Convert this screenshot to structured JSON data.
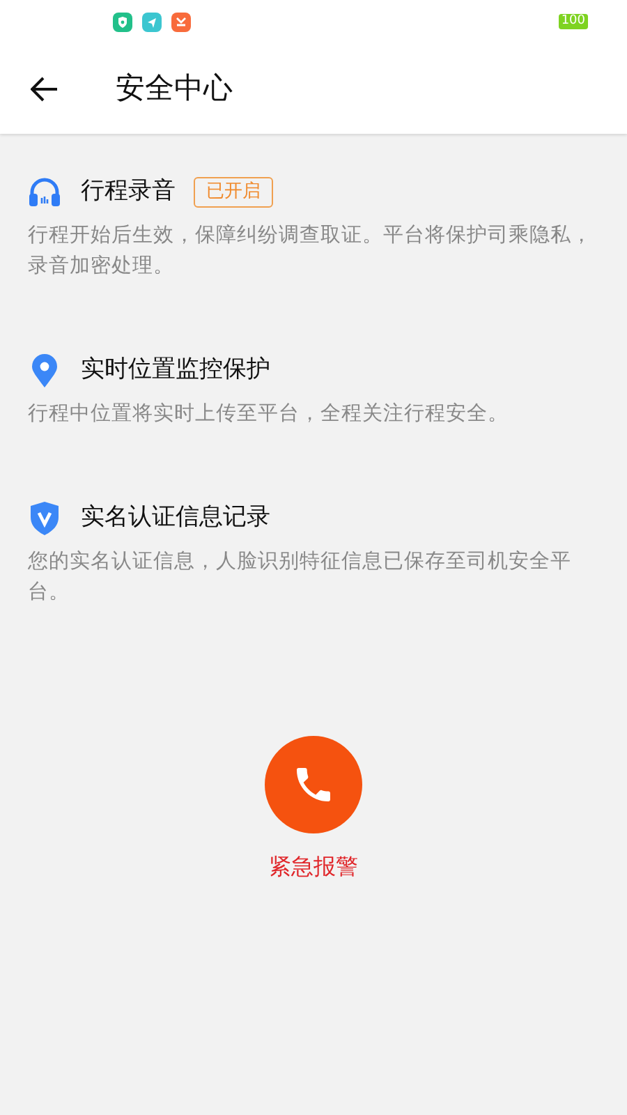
{
  "status_bar": {
    "battery": "100"
  },
  "header": {
    "title": "安全中心"
  },
  "features": [
    {
      "kind": "recording",
      "title": "行程录音",
      "badge": "已开启",
      "description": "行程开始后生效，保障纠纷调查取证。平台将保护司乘隐私，录音加密处理。"
    },
    {
      "kind": "location",
      "title": "实时位置监控保护",
      "description": "行程中位置将实时上传至平台，全程关注行程安全。"
    },
    {
      "kind": "verification",
      "title": "实名认证信息记录",
      "description": "您的实名认证信息，人脸识别特征信息已保存至司机安全平台。"
    }
  ],
  "emergency": {
    "label": "紧急报警"
  }
}
